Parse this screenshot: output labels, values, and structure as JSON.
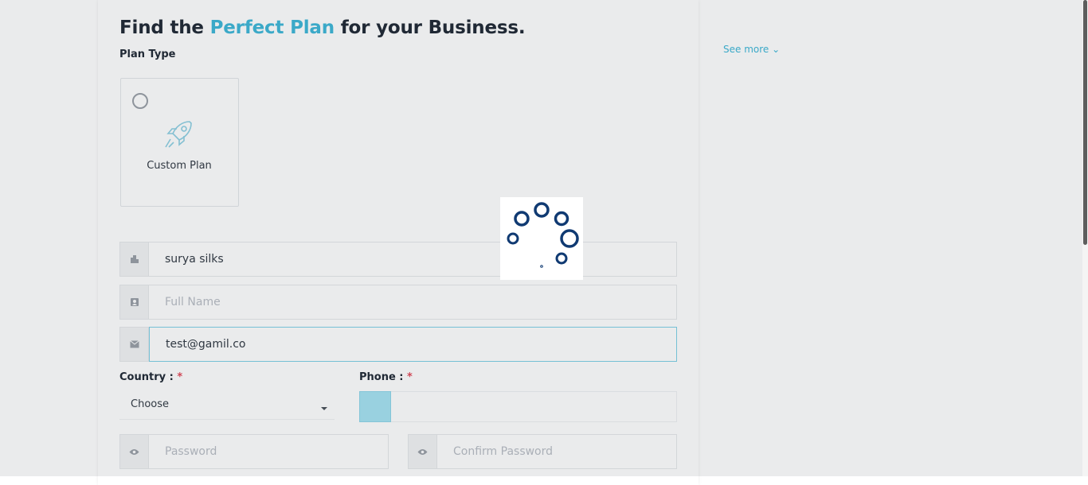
{
  "header": {
    "title_prefix": "Find the",
    "title_accent": "Perfect Plan",
    "title_suffix": "for your Business.",
    "plan_type_label": "Plan Type",
    "see_more": "See more"
  },
  "plans": [
    {
      "label": "Custom Plan",
      "icon": "rocket-icon",
      "selected": false
    }
  ],
  "form": {
    "company": {
      "value": "surya silks",
      "placeholder": "",
      "icon": "building-icon"
    },
    "full_name": {
      "value": "",
      "placeholder": "Full Name",
      "icon": "id-card-icon"
    },
    "email": {
      "value": "test@gamil.co",
      "placeholder": "",
      "icon": "envelope-icon"
    },
    "country": {
      "label": "Country :",
      "required_mark": "*",
      "selected": "Choose"
    },
    "phone": {
      "label": "Phone :",
      "required_mark": "*",
      "value": ""
    },
    "password": {
      "placeholder": "Password",
      "icon": "eye-icon"
    },
    "confirm_password": {
      "placeholder": "Confirm Password",
      "icon": "eye-icon"
    }
  },
  "loader": {
    "state": "loading",
    "color": "#103a72"
  },
  "colors": {
    "accent": "#3fb7d8",
    "required": "#e34b5a",
    "loader": "#103a72"
  }
}
